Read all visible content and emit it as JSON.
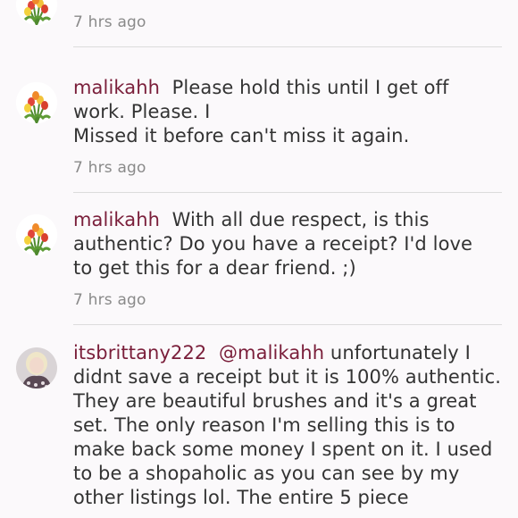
{
  "comments": [
    {
      "user": "",
      "text": "",
      "time": "7 hrs ago",
      "avatar": "tulip-bouquet-avatar"
    },
    {
      "user": "malikahh",
      "text_line1": "Please hold this until I get off",
      "text_rest": "work. Please. I",
      "text_line3": "Missed it before can't miss it again.",
      "time": "7 hrs ago",
      "avatar": "tulip-bouquet-avatar"
    },
    {
      "user": "malikahh",
      "text_line1": "With all due respect, is this",
      "text_line2": "authentic? Do you have a receipt? I'd love",
      "text_line3": "to get this for a dear friend. ;)",
      "time": "7 hrs ago",
      "avatar": "tulip-bouquet-avatar"
    },
    {
      "user": "itsbrittany222",
      "mention": "@malikahh",
      "text_line1": "unfortunately I",
      "text_line2": "didnt save a receipt but it is 100% authentic.",
      "text_line3": "They are beautiful brushes and it's a great",
      "text_line4": "set. The only reason I'm selling this is to",
      "text_line5": "make back some money I spent on it. I used",
      "text_line6": "to be a shopaholic as you can see by my",
      "text_line7": "other listings lol. The entire 5 piece",
      "avatar": "blonde-woman-avatar"
    }
  ],
  "colors": {
    "username": "#7a1e3a",
    "text": "#333333",
    "timestamp": "#8a8a8a",
    "divider": "#dcdcdc",
    "background": "#fbf9fb"
  }
}
